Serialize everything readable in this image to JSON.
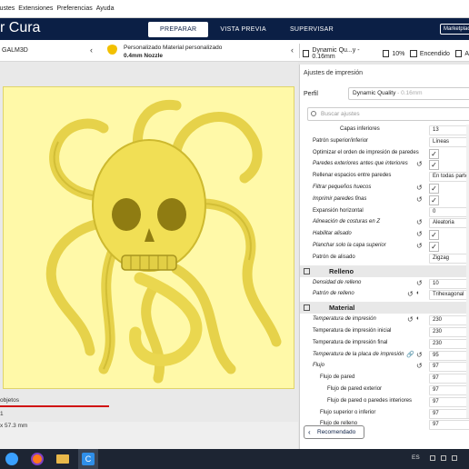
{
  "menubar": {
    "items": [
      "justes",
      "Extensiones",
      "Preferencias",
      "Ayuda"
    ]
  },
  "header": {
    "brand": "r Cura",
    "tabs": [
      "PREPARAR",
      "VISTA PREVIA",
      "SUPERVISAR"
    ],
    "active_tab": "PREPARAR",
    "marketplace": "Marketplace"
  },
  "printer": {
    "name": "GALM3D"
  },
  "material": {
    "line1": "Personalizado Material personalizado",
    "line2": "0.4mm Nozzle"
  },
  "print_summary": {
    "profile": "Dynamic Qu...y - 0.16mm",
    "infill": "10%",
    "support": "Encendido",
    "adhesion_initial": "A"
  },
  "viewport": {
    "objects": "objetos",
    "size_prefix": "1",
    "dimensions": "x 57.3 mm"
  },
  "panel": {
    "title": "Ajustes de impresión",
    "perfil_label": "Perfil",
    "perfil_value": "Dynamic Quality",
    "perfil_dim": "- 0.16mm",
    "search_placeholder": "Buscar ajustes",
    "rows": [
      {
        "label": "Capas inferiores",
        "indent": 2,
        "value": "13",
        "type": "text"
      },
      {
        "label": "Patrón superior/inferior",
        "indent": 1,
        "value": "Líneas",
        "type": "text"
      },
      {
        "label": "Optimizar el orden de impresión de paredes",
        "indent": 1,
        "value": "✓",
        "type": "check"
      },
      {
        "label": "Paredes exteriores antes que interiores",
        "indent": 1,
        "italic": true,
        "reset": true,
        "value": "✓",
        "type": "check"
      },
      {
        "label": "Rellenar espacios entre paredes",
        "indent": 1,
        "value": "En todas partes",
        "type": "text"
      },
      {
        "label": "Filtrar pequeños huecos",
        "indent": 1,
        "italic": true,
        "reset": true,
        "value": "✓",
        "type": "check"
      },
      {
        "label": "Imprimir paredes finas",
        "indent": 1,
        "italic": true,
        "reset": true,
        "value": "✓",
        "type": "check"
      },
      {
        "label": "Expansión horizontal",
        "indent": 1,
        "value": "0",
        "type": "text"
      },
      {
        "label": "Alineación de costuras en Z",
        "indent": 1,
        "italic": true,
        "reset": true,
        "value": "Aleatoria",
        "type": "text"
      },
      {
        "label": "Habilitar alisado",
        "indent": 1,
        "italic": true,
        "reset": true,
        "value": "✓",
        "type": "check"
      },
      {
        "label": "Planchar solo la capa superior",
        "indent": 1,
        "italic": true,
        "reset": true,
        "value": "✓",
        "type": "check"
      },
      {
        "label": "Patrón de alisado",
        "indent": 1,
        "value": "Zigzag",
        "type": "text"
      }
    ],
    "cat_relleno": "Relleno",
    "relleno_rows": [
      {
        "label": "Densidad de relleno",
        "indent": 1,
        "italic": true,
        "reset": true,
        "value": "10",
        "type": "text"
      },
      {
        "label": "Patrón de relleno",
        "indent": 1,
        "italic": true,
        "reset": true,
        "ghost": true,
        "value": "Trihexagonal",
        "type": "text"
      }
    ],
    "cat_material": "Material",
    "material_rows": [
      {
        "label": "Temperatura de impresión",
        "indent": 1,
        "italic": true,
        "reset": true,
        "ghost": true,
        "value": "230",
        "type": "text"
      },
      {
        "label": "Temperatura de impresión inicial",
        "indent": 1,
        "value": "230",
        "type": "text"
      },
      {
        "label": "Temperatura de impresión final",
        "indent": 1,
        "value": "230",
        "type": "text"
      },
      {
        "label": "Temperatura de la placa de impresión",
        "indent": 1,
        "italic": true,
        "link": true,
        "reset": true,
        "value": "95",
        "type": "text"
      },
      {
        "label": "Flujo",
        "indent": 1,
        "italic": true,
        "reset": true,
        "value": "97",
        "type": "text"
      },
      {
        "label": "Flujo de pared",
        "indent": 2,
        "value": "97",
        "type": "text"
      },
      {
        "label": "Flujo de pared exterior",
        "indent": 3,
        "value": "97",
        "type": "text"
      },
      {
        "label": "Flujo de pared o paredes interiores",
        "indent": 3,
        "value": "97",
        "type": "text"
      },
      {
        "label": "Flujo superior o inferior",
        "indent": 2,
        "value": "97",
        "type": "text"
      },
      {
        "label": "Flujo de relleno",
        "indent": 2,
        "value": "97",
        "type": "text"
      }
    ],
    "recommend_label": "Recomendado"
  },
  "taskbar": {
    "lang": "ES",
    "cura_letter": "C"
  }
}
